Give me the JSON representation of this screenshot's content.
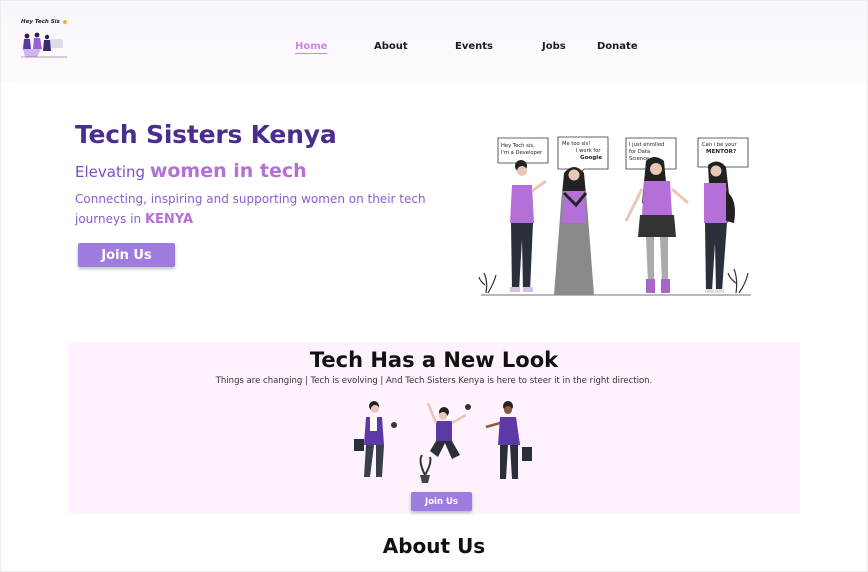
{
  "brand": {
    "logo_text": "Hey Tech Sis"
  },
  "nav": {
    "home": "Home",
    "about": "About",
    "events": "Events",
    "jobs": "Jobs",
    "donate": "Donate"
  },
  "hero": {
    "title": "Tech Sisters Kenya",
    "subtitle_lead": "Elevating",
    "subtitle_highlight": "women in tech",
    "desc_lead": "Connecting, inspiring and supporting women on their tech journeys in",
    "desc_highlight": "KENYA",
    "button": "Join Us",
    "bubbles": {
      "b1": {
        "l1": "Hey Tech sis,",
        "l2": "I'm a Developer"
      },
      "b2": {
        "l1": "Me too sis!",
        "l2": "I work for",
        "l3": "Google"
      },
      "b3": {
        "l1": "I just enrolled",
        "l2": "for Data",
        "l3": "Science"
      },
      "b4": {
        "l1": "Can i be your",
        "l2": "MENTOR?"
      }
    }
  },
  "new_look": {
    "title": "Tech Has a New Look",
    "tagline": "Things are changing  |  Tech is evolving  |  And Tech Sisters Kenya is here to steer it in the right direction.",
    "button": "Join Us"
  },
  "about": {
    "title": "About Us"
  },
  "colors": {
    "primary": "#4a2d8c",
    "accent": "#b46fd9",
    "button": "#9f7ce0",
    "section_bg": "#fdf2fd",
    "nav_active": "#c58be0"
  }
}
